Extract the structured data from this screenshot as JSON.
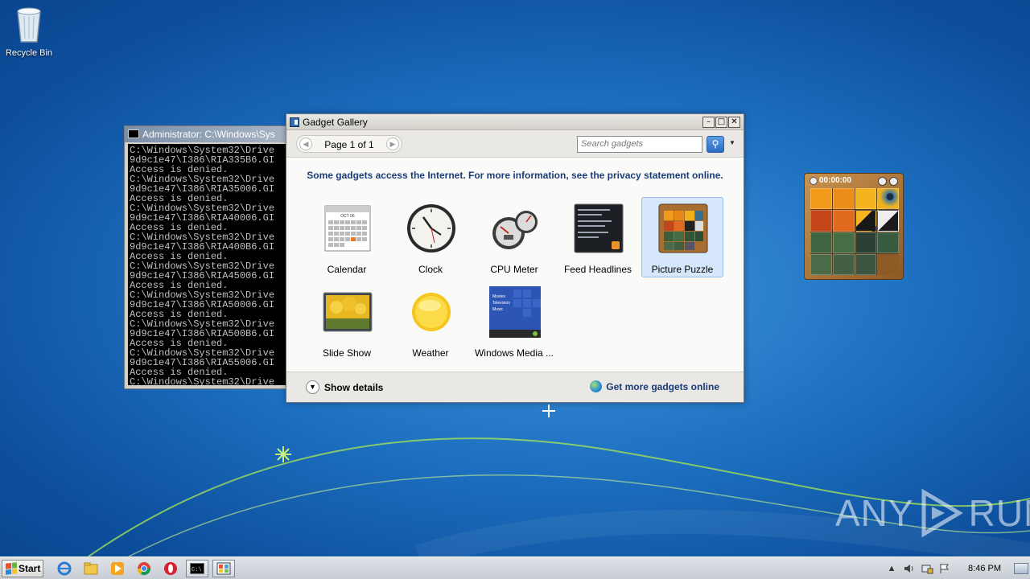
{
  "desktop": {
    "recycle_bin_label": "Recycle Bin"
  },
  "console": {
    "title": "Administrator: C:\\Windows\\Sys",
    "lines": "C:\\Windows\\System32\\Drive\n9d9c1e47\\I386\\RIA335B6.GI\nAccess is denied.\nC:\\Windows\\System32\\Drive\n9d9c1e47\\I386\\RIA35006.GI\nAccess is denied.\nC:\\Windows\\System32\\Drive\n9d9c1e47\\I386\\RIA40006.GI\nAccess is denied.\nC:\\Windows\\System32\\Drive\n9d9c1e47\\I386\\RIA400B6.GI\nAccess is denied.\nC:\\Windows\\System32\\Drive\n9d9c1e47\\I386\\RIA45006.GI\nAccess is denied.\nC:\\Windows\\System32\\Drive\n9d9c1e47\\I386\\RIA50006.GI\nAccess is denied.\nC:\\Windows\\System32\\Drive\n9d9c1e47\\I386\\RIA500B6.GI\nAccess is denied.\nC:\\Windows\\System32\\Drive\n9d9c1e47\\I386\\RIA55006.GI\nAccess is denied.\nC:\\Windows\\System32\\Drive"
  },
  "gallery": {
    "title": "Gadget Gallery",
    "page_label": "Page 1 of 1",
    "search_placeholder": "Search gadgets",
    "notice": "Some gadgets access the Internet.  For more information, see the privacy statement online.",
    "gadgets": [
      {
        "label": "Calendar",
        "icon": "calendar-icon"
      },
      {
        "label": "Clock",
        "icon": "clock-icon"
      },
      {
        "label": "CPU Meter",
        "icon": "cpu-meter-icon"
      },
      {
        "label": "Feed Headlines",
        "icon": "feed-headlines-icon"
      },
      {
        "label": "Picture Puzzle",
        "icon": "picture-puzzle-icon",
        "selected": true
      },
      {
        "label": "Slide Show",
        "icon": "slide-show-icon"
      },
      {
        "label": "Weather",
        "icon": "weather-icon"
      },
      {
        "label": "Windows Media ...",
        "icon": "windows-media-center-icon"
      }
    ],
    "calendar_month": "OCT 06",
    "media_center_items": [
      "Movies",
      "Television",
      "Music"
    ],
    "show_details": "Show details",
    "get_more": "Get more gadgets online"
  },
  "puzzle_gadget": {
    "timer": "00:00:00"
  },
  "taskbar": {
    "start_label": "Start",
    "clock": "8:46 PM",
    "pinned": [
      "internet-explorer-icon",
      "explorer-icon",
      "media-player-icon",
      "chrome-icon",
      "opera-icon",
      "cmd-icon",
      "gadget-gallery-icon"
    ]
  },
  "watermark": {
    "text_a": "ANY",
    "text_b": "RUN"
  },
  "colors": {
    "accent": "#1b3d78",
    "selection": "#d7e7fb"
  }
}
